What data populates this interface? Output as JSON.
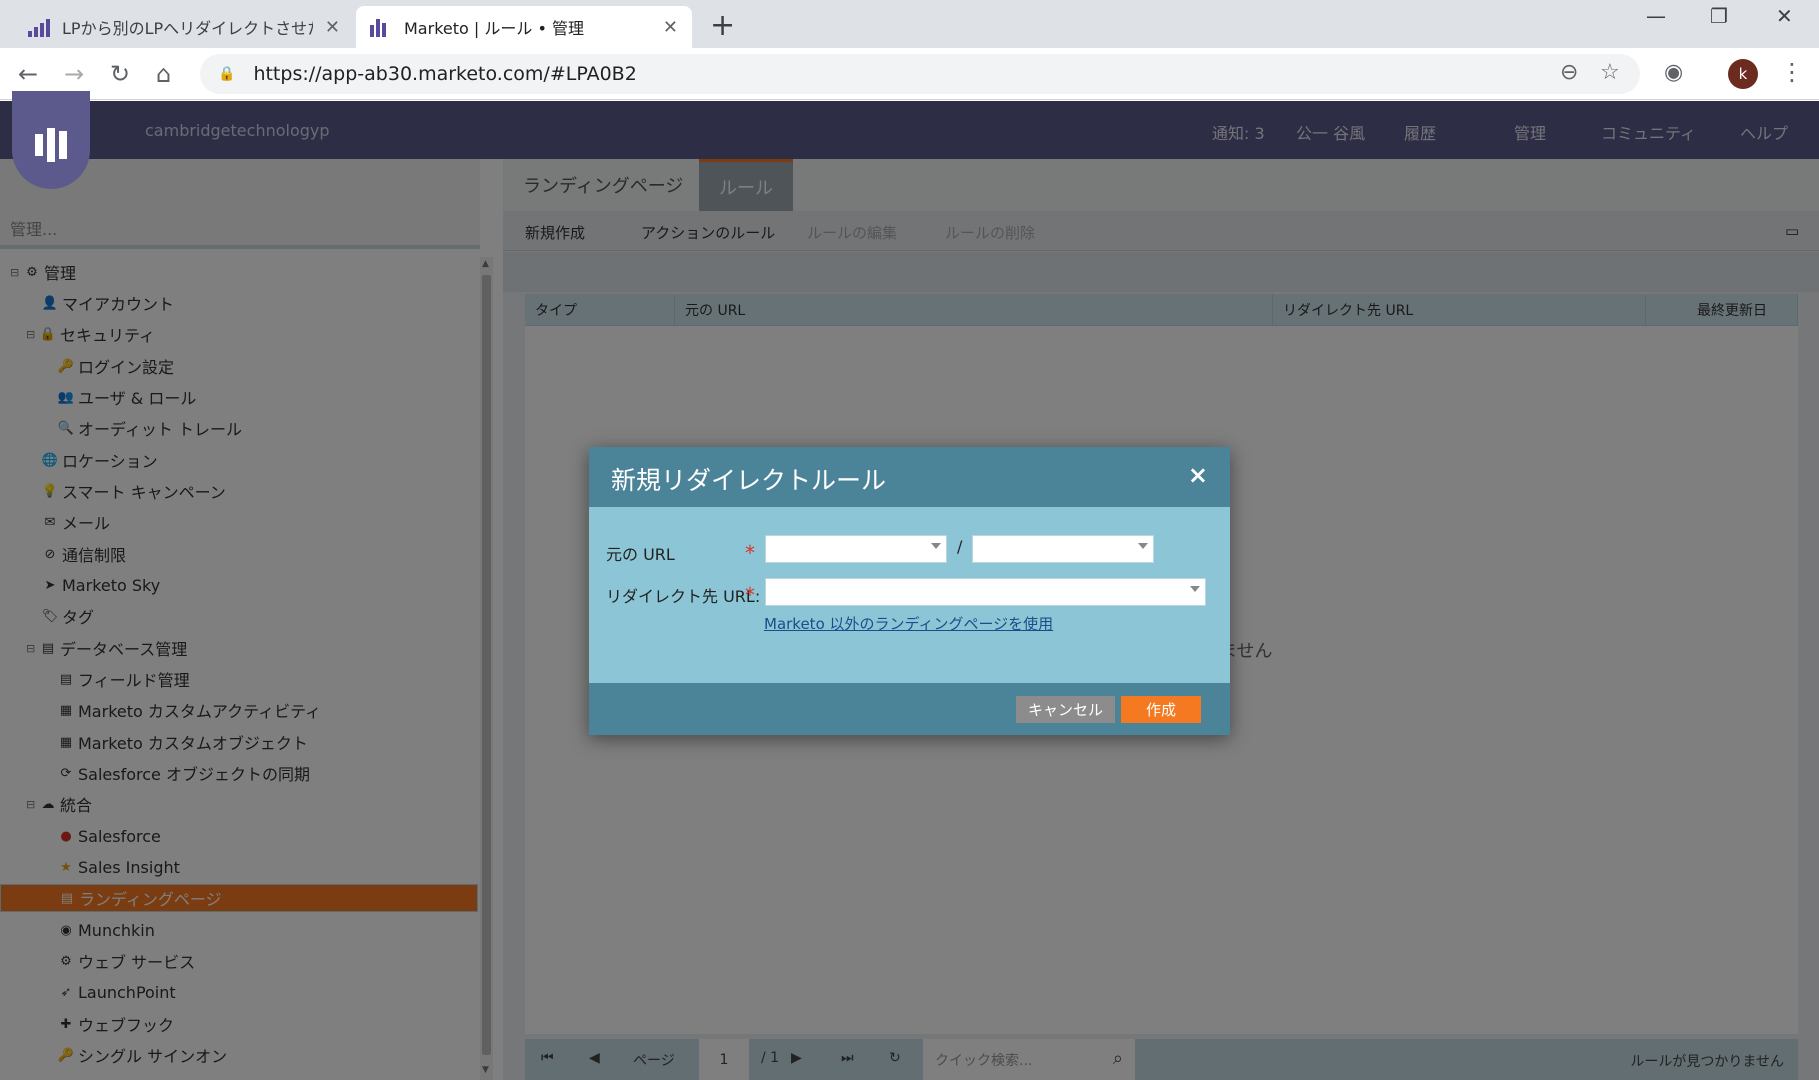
{
  "browser": {
    "tabs": [
      {
        "title": "LPから別のLPへリダイレクトさせたい |"
      },
      {
        "title": "Marketo | ルール • 管理"
      }
    ],
    "url": "https://app-ab30.marketo.com/#LPA0B2",
    "profile_initial": "k",
    "icons": {
      "back": "←",
      "forward": "→",
      "reload": "↻",
      "home": "⌂",
      "zoom": "⊖",
      "star": "☆",
      "camera": "◉",
      "menu": "⋮",
      "close": "✕",
      "newtab": "+",
      "minimize": "—",
      "restore": "❐",
      "winclose": "✕"
    }
  },
  "app": {
    "tenant": "cambridgetechnologyp",
    "topnav": [
      "通知: 3",
      "公一 谷風",
      "履歴",
      "管理",
      "コミュニティ",
      "ヘルプ"
    ],
    "sidebar_search_placeholder": "管理...",
    "tree": [
      {
        "label": "管理",
        "expander": "⊟",
        "icon": "⚙"
      },
      {
        "label": "マイアカウント",
        "icon": "👤"
      },
      {
        "label": "セキュリティ",
        "expander": "⊟",
        "icon": "🔒"
      },
      {
        "label": "ログイン設定",
        "icon": "🔑"
      },
      {
        "label": "ユーザ & ロール",
        "icon": "👥"
      },
      {
        "label": "オーディット トレール",
        "icon": "🔍"
      },
      {
        "label": "ロケーション",
        "icon": "🌐"
      },
      {
        "label": "スマート キャンペーン",
        "icon": "💡"
      },
      {
        "label": "メール",
        "icon": "✉"
      },
      {
        "label": "通信制限",
        "icon": "⊘"
      },
      {
        "label": "Marketo Sky",
        "icon": "➤"
      },
      {
        "label": "タグ",
        "icon": "🏷"
      },
      {
        "label": "データベース管理",
        "expander": "⊟",
        "icon": "▤"
      },
      {
        "label": "フィールド管理",
        "icon": "▤"
      },
      {
        "label": "Marketo カスタムアクティビティ",
        "icon": "▦"
      },
      {
        "label": "Marketo カスタムオブジェクト",
        "icon": "▦"
      },
      {
        "label": "Salesforce オブジェクトの同期",
        "icon": "⟳"
      },
      {
        "label": "統合",
        "expander": "⊟",
        "icon": "☁"
      },
      {
        "label": "Salesforce",
        "icon": "●"
      },
      {
        "label": "Sales Insight",
        "icon": "★"
      },
      {
        "label": "ランディングページ",
        "icon": "▤"
      },
      {
        "label": "Munchkin",
        "icon": "◉"
      },
      {
        "label": "ウェブ サービス",
        "icon": "⚙"
      },
      {
        "label": "LaunchPoint",
        "icon": "➶"
      },
      {
        "label": "ウェブフック",
        "icon": "✚"
      },
      {
        "label": "シングル サインオン",
        "icon": "🔑"
      }
    ],
    "main_tabs": [
      "ランディングページ",
      "ルール"
    ],
    "toolbar": [
      "新規作成",
      "アクションのルール",
      "ルールの編集",
      "ルールの削除"
    ],
    "grid_columns": [
      "タイプ",
      "元の URL",
      "リダイレクト先 URL",
      "最終更新日"
    ],
    "empty_message": "ません",
    "pager": {
      "page_label": "ページ",
      "page_value": "1",
      "page_total": "/ 1",
      "search_placeholder": "クイック検索...",
      "status": "ルールが見つかりません"
    }
  },
  "dialog": {
    "title": "新規リダイレクトルール",
    "close": "×",
    "source_url_label": "元の URL",
    "redirect_url_label": "リダイレクト先 URL:",
    "required_mark": "*",
    "separator": "/",
    "external_link": "Marketo 以外のランディングページを使用",
    "cancel": "キャンセル",
    "create": "作成"
  },
  "colors": {
    "nav_purple": "#5c5a8c",
    "accent_orange": "#f47920",
    "dialog_header": "#4b8498",
    "dialog_body": "#8cc6d6"
  }
}
